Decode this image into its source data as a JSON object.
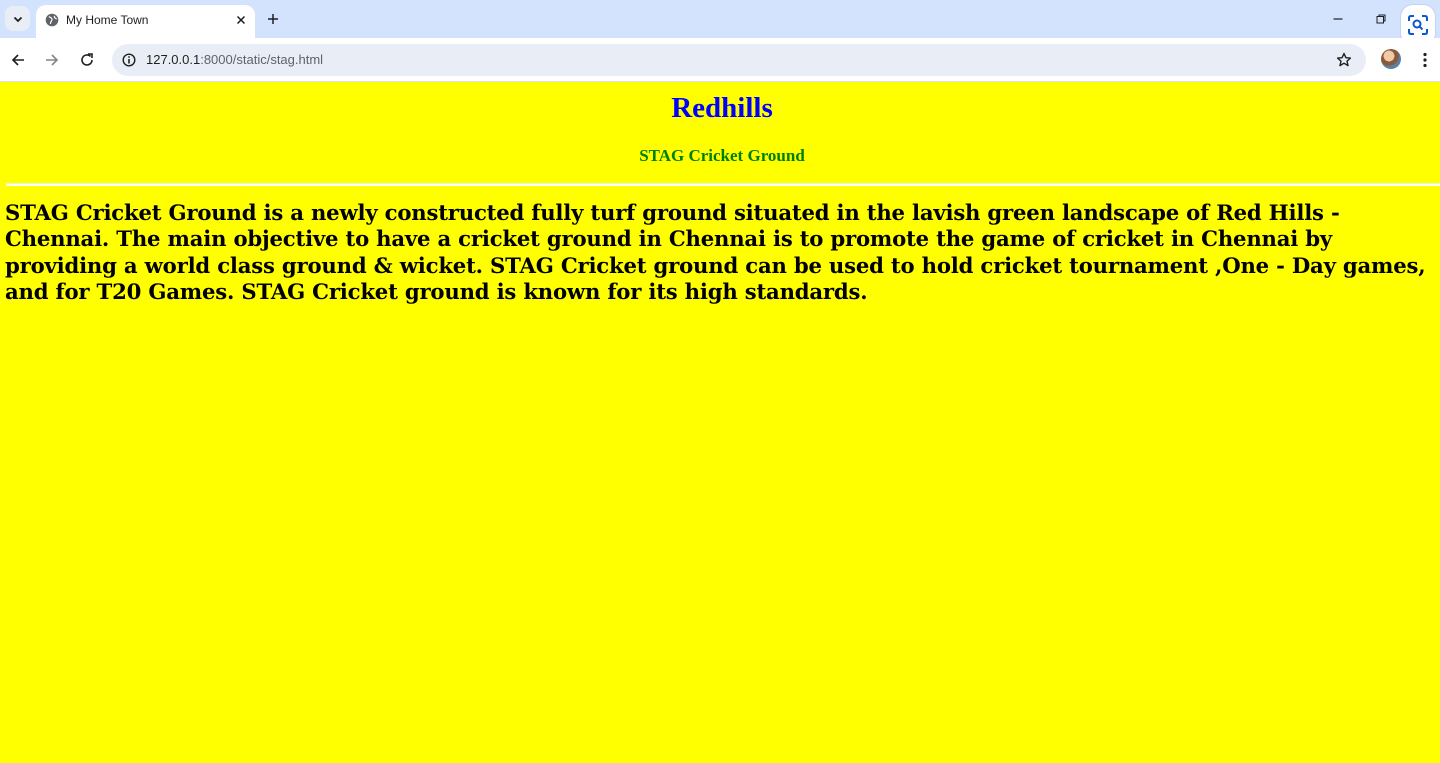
{
  "browser": {
    "tab": {
      "title": "My Home Town"
    },
    "address_bar": {
      "host": "127.0.0.1",
      "path": ":8000/static/stag.html"
    }
  },
  "page": {
    "title": "Redhills",
    "subtitle": "STAG Cricket Ground",
    "paragraph": "STAG Cricket Ground is a newly constructed fully turf ground situated in the lavish green landscape of Red Hills - Chennai. The main objective to have a cricket ground in Chennai is to promote the game of cricket in Chennai by providing a world class ground & wicket. STAG Cricket ground can be used to hold cricket tournament ,One - Day games, and for T20 Games. STAG Cricket ground is known for its high standards."
  },
  "colors": {
    "page_background": "#ffff00",
    "title": "#0000ff",
    "subtitle": "#008000",
    "tabstrip": "#d3e3fd"
  }
}
